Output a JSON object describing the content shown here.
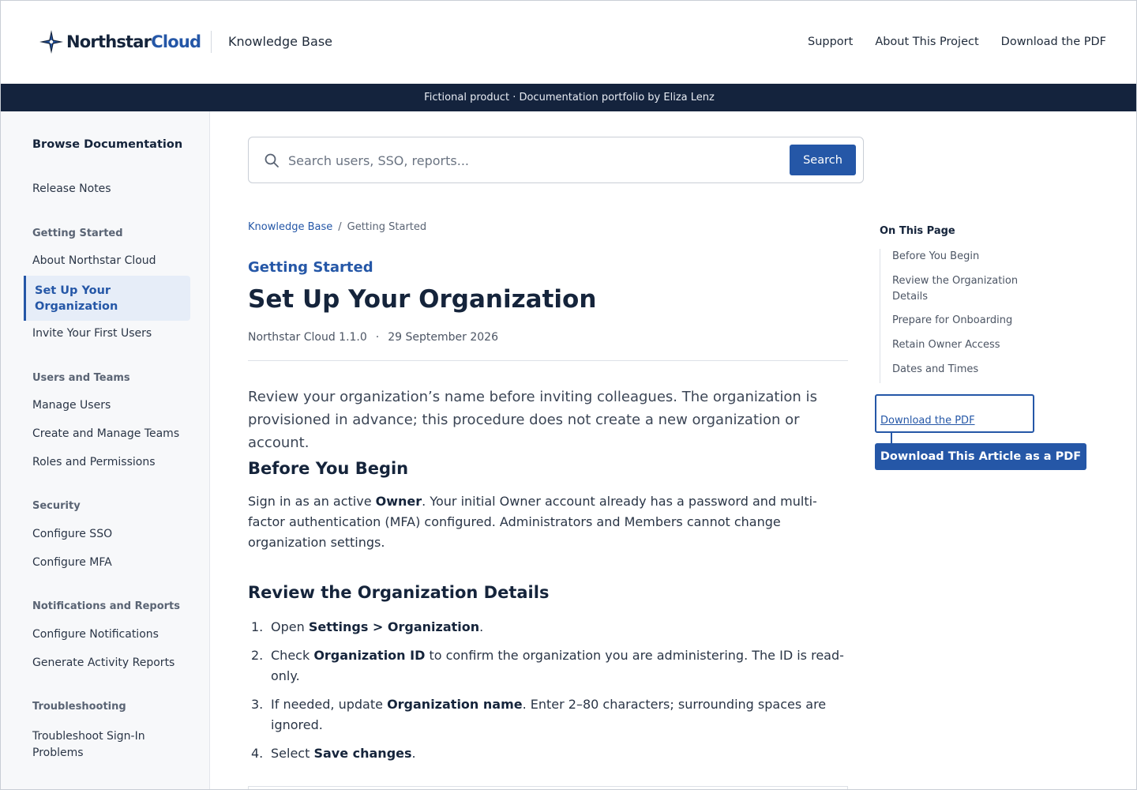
{
  "header": {
    "logo_word_1": "Northstar",
    "logo_word_2": "Cloud",
    "section_title": "Knowledge Base",
    "nav": [
      "Support",
      "About This Project",
      "Download the PDF"
    ]
  },
  "banner": "Fictional product · Documentation portfolio by Eliza Lenz",
  "sidebar": {
    "title": "Browse Documentation",
    "release_notes": "Release Notes",
    "sections": [
      {
        "heading": "Getting Started",
        "items": [
          "About Northstar Cloud",
          "Set Up Your Organization",
          "Invite Your First Users"
        ]
      },
      {
        "heading": "Users and Teams",
        "items": [
          "Manage Users",
          "Create and Manage Teams",
          "Roles and Permissions"
        ]
      },
      {
        "heading": "Security",
        "items": [
          "Configure SSO",
          "Configure MFA"
        ]
      },
      {
        "heading": "Notifications and Reports",
        "items": [
          "Configure Notifications",
          "Generate Activity Reports"
        ]
      },
      {
        "heading": "Troubleshooting",
        "items": [
          "Troubleshoot Sign-In Problems"
        ]
      }
    ],
    "active_item": "Set Up Your Organization"
  },
  "search": {
    "placeholder": "Search users, SSO, reports...",
    "button": "Search"
  },
  "breadcrumb": [
    "Knowledge Base",
    "Getting Started"
  ],
  "breadcrumb_sep": "/",
  "article": {
    "category": "Getting Started",
    "title": "Set Up Your Organization",
    "version": "Northstar Cloud 1.1.0",
    "meta_sep": "·",
    "date": "29 September 2026",
    "intro": "Review your organization’s name before inviting colleagues. The organization is provisioned in advance; this procedure does not create a new organization or account.",
    "sections": [
      {
        "heading": "Before You Begin",
        "body": {
          "pre": "Sign in as an active ",
          "bold": "Owner",
          "post": ". Your initial Owner account already has a password and multi-factor authentication (MFA) configured. Administrators and Members cannot change organization settings."
        }
      },
      {
        "heading": "Review the Organization Details",
        "steps": [
          {
            "num": "1.",
            "pre": "Open ",
            "bold": "Settings > Organization",
            "post": "."
          },
          {
            "num": "2.",
            "pre": "Check ",
            "bold": "Organization ID",
            "post": " to confirm the organization you are administering. The ID is read-only."
          },
          {
            "num": "3.",
            "pre": "If needed, update ",
            "bold": "Organization name",
            "post": ". Enter 2–80 characters; surrounding spaces are ignored."
          },
          {
            "num": "4.",
            "pre": "Select ",
            "bold": "Save changes",
            "post": "."
          }
        ]
      }
    ]
  },
  "toc": {
    "title": "On This Page",
    "items": [
      "Before You Begin",
      "Review the Organization Details",
      "Prepare for Onboarding",
      "Retain Owner Access",
      "Dates and Times"
    ]
  },
  "pdf": {
    "link": "Download the PDF",
    "button": "Download This Article as a PDF"
  },
  "colors": {
    "accent": "#2557a7",
    "banner_bg": "#14233d",
    "sidebar_bg": "#f7f8fa"
  }
}
